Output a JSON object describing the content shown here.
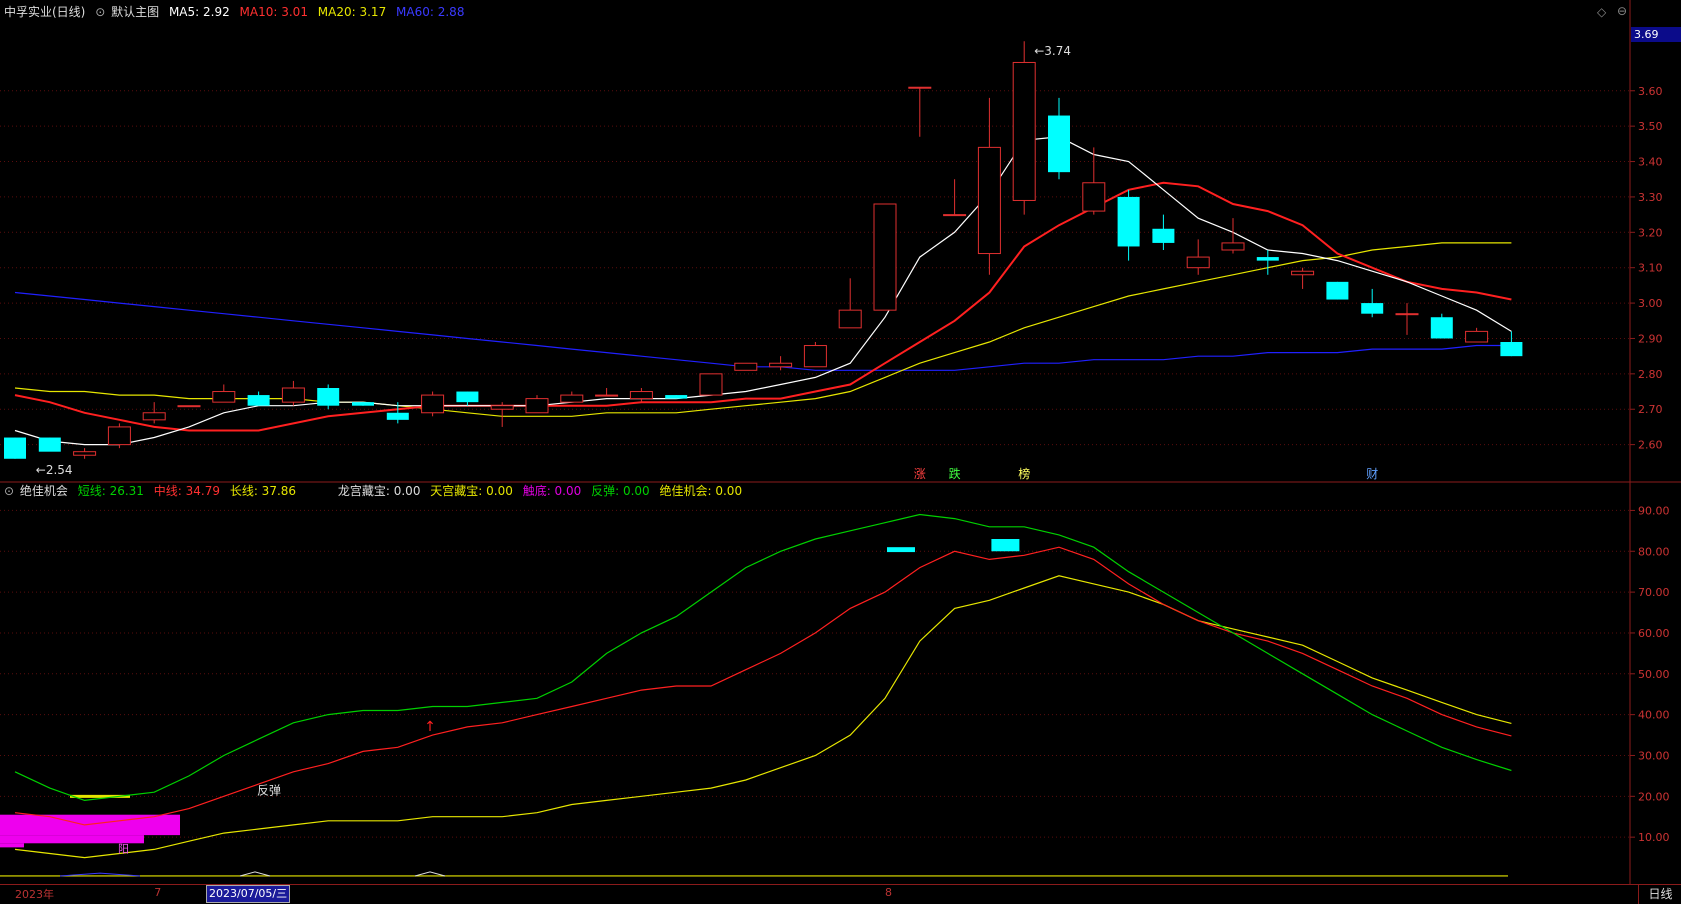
{
  "header": {
    "stock": "中孚实业(日线)",
    "template": "默认主图",
    "ma5": "MA5: 2.92",
    "ma10": "MA10: 3.01",
    "ma20": "MA20: 3.17",
    "ma60": "MA60: 2.88"
  },
  "indicator": {
    "name": "绝佳机会",
    "short": "短线: 26.31",
    "mid": "中线: 34.79",
    "long": "长线: 37.86",
    "extra": [
      {
        "label": "龙宫藏宝: 0.00",
        "color": "#dddddd"
      },
      {
        "label": "天宫藏宝: 0.00",
        "color": "#e6e600"
      },
      {
        "label": "触底: 0.00",
        "color": "#e000e0"
      },
      {
        "label": "反弹: 0.00",
        "color": "#00d000"
      },
      {
        "label": "绝佳机会: 0.00",
        "color": "#e6e600"
      }
    ]
  },
  "colors": {
    "up": "#e03030",
    "down": "#00ffff",
    "ma5": "#ffffff",
    "ma10": "#ff2020",
    "ma20": "#e6e600",
    "ma60": "#2020ff",
    "short": "#00d000",
    "mid": "#ff2020",
    "long": "#e6e600",
    "grid": "#5a0d0d",
    "axis": "#8b1b1b"
  },
  "current_price": "3.69",
  "axis_price": [
    "3.60",
    "3.50",
    "3.40",
    "3.30",
    "3.20",
    "3.10",
    "3.00",
    "2.90",
    "2.80",
    "2.70",
    "2.60"
  ],
  "axis_ind": [
    "90.00",
    "80.00",
    "70.00",
    "60.00",
    "50.00",
    "40.00",
    "30.00",
    "20.00",
    "10.00"
  ],
  "annotations": {
    "high": "3.74",
    "low": "2.54",
    "fantan": "反弹",
    "yang": "阳"
  },
  "markers": [
    {
      "label": "涨",
      "idx": 26,
      "color": "#ff4040"
    },
    {
      "label": "跌",
      "idx": 27,
      "color": "#40ff40"
    },
    {
      "label": "榜",
      "idx": 29,
      "color": "#ffff60"
    },
    {
      "label": "财",
      "idx": 39,
      "color": "#60a0ff"
    }
  ],
  "dates": [
    {
      "label": "2023年",
      "idx": 0
    },
    {
      "label": "7",
      "idx": 4
    },
    {
      "label": "8",
      "idx": 25
    }
  ],
  "date_current": "2023/07/05/三",
  "period": "日线",
  "chart_data": {
    "type": "candlestick",
    "ylim": [
      2.5,
      3.8
    ],
    "ohlc": [
      [
        2.62,
        2.62,
        2.56,
        2.56
      ],
      [
        2.62,
        2.62,
        2.59,
        2.58
      ],
      [
        2.57,
        2.59,
        2.56,
        2.58
      ],
      [
        2.6,
        2.66,
        2.59,
        2.65
      ],
      [
        2.67,
        2.72,
        2.66,
        2.69
      ],
      [
        2.71,
        2.71,
        2.71,
        2.71
      ],
      [
        2.72,
        2.77,
        2.72,
        2.75
      ],
      [
        2.74,
        2.75,
        2.71,
        2.71
      ],
      [
        2.72,
        2.78,
        2.71,
        2.76
      ],
      [
        2.76,
        2.77,
        2.7,
        2.71
      ],
      [
        2.72,
        2.72,
        2.71,
        2.71
      ],
      [
        2.69,
        2.72,
        2.66,
        2.67
      ],
      [
        2.69,
        2.75,
        2.68,
        2.74
      ],
      [
        2.75,
        2.75,
        2.71,
        2.72
      ],
      [
        2.7,
        2.72,
        2.65,
        2.71
      ],
      [
        2.69,
        2.74,
        2.69,
        2.73
      ],
      [
        2.72,
        2.75,
        2.72,
        2.74
      ],
      [
        2.74,
        2.76,
        2.74,
        2.74
      ],
      [
        2.73,
        2.76,
        2.72,
        2.75
      ],
      [
        2.74,
        2.74,
        2.73,
        2.73
      ],
      [
        2.74,
        2.8,
        2.74,
        2.8
      ],
      [
        2.81,
        2.83,
        2.81,
        2.83
      ],
      [
        2.82,
        2.85,
        2.81,
        2.83
      ],
      [
        2.82,
        2.89,
        2.82,
        2.88
      ],
      [
        2.93,
        3.07,
        2.93,
        2.98
      ],
      [
        2.98,
        3.28,
        2.98,
        3.28
      ],
      [
        3.61,
        3.61,
        3.47,
        3.61
      ],
      [
        3.25,
        3.35,
        3.25,
        3.25
      ],
      [
        3.14,
        3.58,
        3.08,
        3.44
      ],
      [
        3.29,
        3.74,
        3.25,
        3.68
      ],
      [
        3.53,
        3.58,
        3.35,
        3.37
      ],
      [
        3.26,
        3.44,
        3.25,
        3.34
      ],
      [
        3.3,
        3.32,
        3.12,
        3.16
      ],
      [
        3.21,
        3.25,
        3.15,
        3.17
      ],
      [
        3.1,
        3.18,
        3.08,
        3.13
      ],
      [
        3.15,
        3.24,
        3.14,
        3.17
      ],
      [
        3.13,
        3.15,
        3.08,
        3.12
      ],
      [
        3.08,
        3.1,
        3.04,
        3.09
      ],
      [
        3.06,
        3.06,
        3.01,
        3.01
      ],
      [
        3.0,
        3.04,
        2.96,
        2.97
      ],
      [
        2.97,
        3.0,
        2.91,
        2.97
      ],
      [
        2.96,
        2.97,
        2.9,
        2.9
      ],
      [
        2.89,
        2.93,
        2.89,
        2.92
      ],
      [
        2.89,
        2.92,
        2.85,
        2.85
      ]
    ],
    "ma5": [
      2.64,
      2.61,
      2.6,
      2.6,
      2.62,
      2.65,
      2.69,
      2.71,
      2.71,
      2.72,
      2.72,
      2.71,
      2.71,
      2.71,
      2.71,
      2.71,
      2.72,
      2.73,
      2.73,
      2.73,
      2.74,
      2.75,
      2.77,
      2.79,
      2.83,
      2.96,
      3.13,
      3.2,
      3.31,
      3.46,
      3.47,
      3.42,
      3.4,
      3.32,
      3.24,
      3.2,
      3.15,
      3.14,
      3.12,
      3.09,
      3.06,
      3.02,
      2.98,
      2.92
    ],
    "ma10": [
      2.74,
      2.72,
      2.69,
      2.67,
      2.65,
      2.64,
      2.64,
      2.64,
      2.66,
      2.68,
      2.69,
      2.7,
      2.71,
      2.71,
      2.71,
      2.71,
      2.71,
      2.71,
      2.72,
      2.72,
      2.72,
      2.73,
      2.73,
      2.75,
      2.77,
      2.83,
      2.89,
      2.95,
      3.03,
      3.16,
      3.22,
      3.27,
      3.32,
      3.34,
      3.33,
      3.28,
      3.26,
      3.22,
      3.14,
      3.1,
      3.06,
      3.04,
      3.03,
      3.01
    ],
    "ma20": [
      2.76,
      2.75,
      2.75,
      2.74,
      2.74,
      2.73,
      2.73,
      2.73,
      2.73,
      2.72,
      2.72,
      2.71,
      2.7,
      2.69,
      2.68,
      2.68,
      2.68,
      2.69,
      2.69,
      2.69,
      2.7,
      2.71,
      2.72,
      2.73,
      2.75,
      2.79,
      2.83,
      2.86,
      2.89,
      2.93,
      2.96,
      2.99,
      3.02,
      3.04,
      3.06,
      3.08,
      3.1,
      3.12,
      3.13,
      3.15,
      3.16,
      3.17,
      3.17,
      3.17
    ],
    "ma60": [
      3.03,
      3.02,
      3.01,
      3.0,
      2.99,
      2.98,
      2.97,
      2.96,
      2.95,
      2.94,
      2.93,
      2.92,
      2.91,
      2.9,
      2.89,
      2.88,
      2.87,
      2.86,
      2.85,
      2.84,
      2.83,
      2.82,
      2.82,
      2.81,
      2.81,
      2.81,
      2.81,
      2.81,
      2.82,
      2.83,
      2.83,
      2.84,
      2.84,
      2.84,
      2.85,
      2.85,
      2.86,
      2.86,
      2.86,
      2.87,
      2.87,
      2.87,
      2.88,
      2.88
    ],
    "indicator_ylim": [
      0,
      95
    ],
    "short": [
      26,
      22,
      19,
      20,
      21,
      25,
      30,
      34,
      38,
      40,
      41,
      41,
      42,
      42,
      43,
      44,
      48,
      55,
      60,
      64,
      70,
      76,
      80,
      83,
      85,
      87,
      89,
      88,
      86,
      86,
      84,
      81,
      75,
      70,
      65,
      60,
      55,
      50,
      45,
      40,
      36,
      32,
      29,
      26.31
    ],
    "mid": [
      16,
      15,
      13,
      14,
      15,
      17,
      20,
      23,
      26,
      28,
      31,
      32,
      35,
      37,
      38,
      40,
      42,
      44,
      46,
      47,
      47,
      51,
      55,
      60,
      66,
      70,
      76,
      80,
      78,
      79,
      81,
      78,
      72,
      67,
      63,
      60,
      58,
      55,
      51,
      47,
      44,
      40,
      37,
      34.79
    ],
    "long": [
      7,
      6,
      5,
      6,
      7,
      9,
      11,
      12,
      13,
      14,
      14,
      14,
      15,
      15,
      15,
      16,
      18,
      19,
      20,
      21,
      22,
      24,
      27,
      30,
      35,
      44,
      58,
      66,
      68,
      71,
      74,
      72,
      70,
      67,
      63,
      61,
      59,
      57,
      53,
      49,
      46,
      43,
      40,
      37.86
    ]
  }
}
